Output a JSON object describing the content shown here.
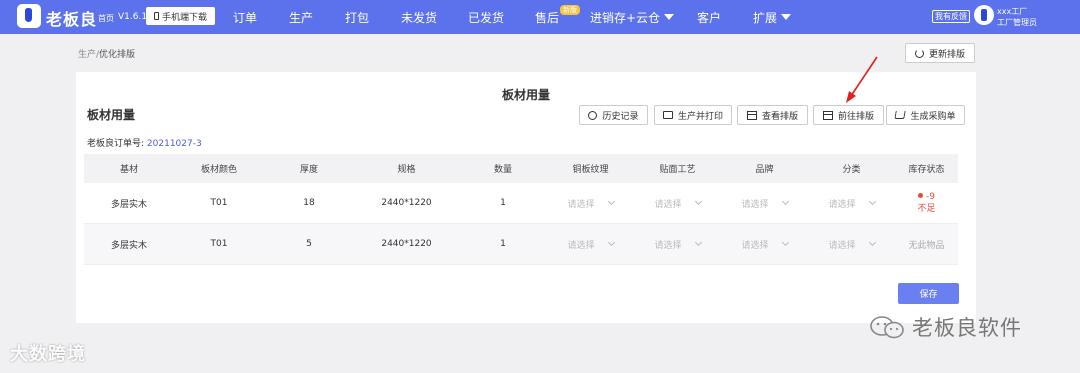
{
  "topbar": {
    "brand": "老板良",
    "home": "首页",
    "version": "V1.6.1",
    "download_label": "手机端下载",
    "nav": [
      {
        "label": "订单"
      },
      {
        "label": "生产"
      },
      {
        "label": "打包"
      },
      {
        "label": "未发货"
      },
      {
        "label": "已发货"
      },
      {
        "label": "售后"
      },
      {
        "label": "进销存+云仓"
      },
      {
        "label": "客户"
      },
      {
        "label": "扩展"
      }
    ],
    "new_badge": "新版",
    "feedback": "我有反馈",
    "user_name": "xxx工厂",
    "user_role": "工厂管理员",
    "bg_color": "#5b72ec"
  },
  "breadcrumb": {
    "parent": "生产/",
    "current": "优化排版"
  },
  "refresh_button": "更新排版",
  "card": {
    "title_center": "板材用量",
    "title_left": "板材用量",
    "toolbar": {
      "history": "历史记录",
      "produce_print": "生产并打印",
      "view_layout": "查看排版",
      "go_layout": "前往排版",
      "purchase": "生成采购单"
    },
    "order_label": "老板良订单号:",
    "order_no": "20211027-3",
    "table": {
      "headers": [
        "基材",
        "板材颜色",
        "厚度",
        "规格",
        "数量",
        "铜板纹理",
        "贴面工艺",
        "品牌",
        "分类",
        "库存状态"
      ],
      "rows": [
        {
          "material": "多层实木",
          "color": "T01",
          "thickness": "18",
          "spec": "2440*1220",
          "qty": "1",
          "texture": "请选择",
          "process": "请选择",
          "brand": "请选择",
          "category": "请选择",
          "stock_value": "-9",
          "stock_text": "不足"
        },
        {
          "material": "多层实木",
          "color": "T01",
          "thickness": "5",
          "spec": "2440*1220",
          "qty": "1",
          "texture": "请选择",
          "process": "请选择",
          "brand": "请选择",
          "category": "请选择",
          "stock_text": "无此物品"
        }
      ]
    },
    "save_label": "保存"
  },
  "watermark": {
    "left": "大数跨境",
    "right": "老板良软件"
  },
  "colors": {
    "accent": "#6a7ff0",
    "link": "#4a5ce0",
    "danger": "#e64a3b",
    "arrow": "#e02020"
  }
}
